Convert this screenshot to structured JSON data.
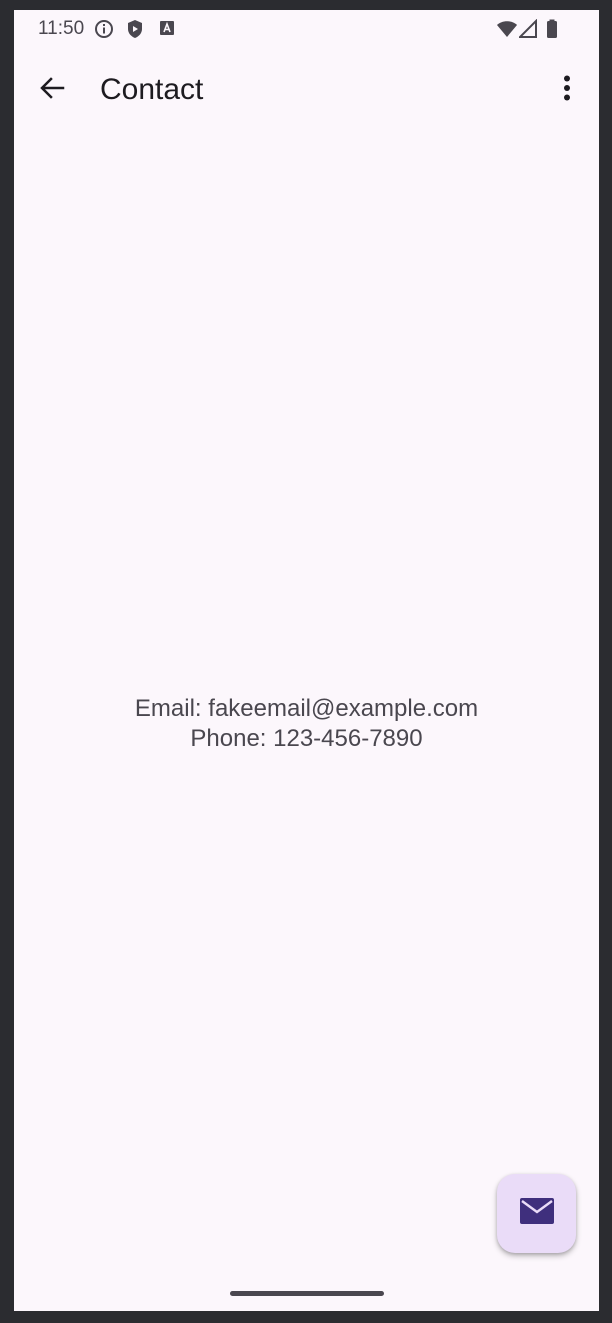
{
  "status_bar": {
    "time": "11:50",
    "icons": [
      "info-icon",
      "shield-icon",
      "font-a-icon",
      "wifi-icon",
      "signal-icon",
      "battery-icon"
    ]
  },
  "app_bar": {
    "title": "Contact",
    "back_icon": "arrow-back-icon",
    "more_icon": "more-vert-icon"
  },
  "contact": {
    "email_line": "Email: fakeemail@example.com",
    "phone_line": "Phone: 123-456-7890"
  },
  "fab": {
    "icon": "email-icon"
  },
  "colors": {
    "background": "#fcf7fc",
    "fab_background": "#eadcf8",
    "fab_icon": "#3f2f7d",
    "text_primary": "#1d1b20",
    "text_secondary": "#4a474f"
  }
}
